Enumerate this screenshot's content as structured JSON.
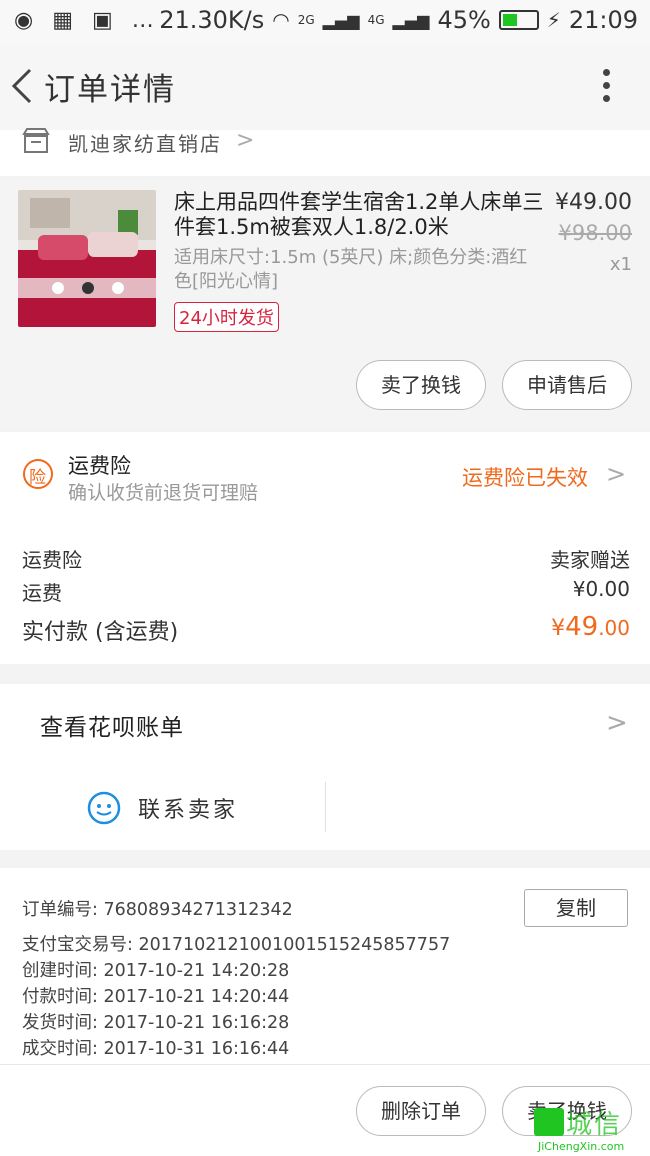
{
  "status_bar": {
    "left_icons": "◉ ▦ ▣ …",
    "net_speed": "21.30K/s",
    "signal_2g": "2G",
    "signal_4g": "4G",
    "battery_percent": "45%",
    "time": "21:09"
  },
  "header": {
    "title": "订单详情"
  },
  "shop": {
    "name": "凯迪家纺直销店"
  },
  "product": {
    "title": "床上用品四件套学生宿舍1.2单人床单三件套1.5m被套双人1.8/2.0米",
    "spec": "适用床尺寸:1.5m (5英尺) 床;颜色分类:酒红色[阳光心情]",
    "badge": "24小时发货",
    "price_now": "¥49.00",
    "price_old": "¥98.00",
    "quantity": "x1",
    "actions": [
      "卖了换钱",
      "申请售后"
    ]
  },
  "insurance": {
    "title": "运费险",
    "desc": "确认收货前退货可理赔",
    "status": "运费险已失效",
    "icon_char": "险"
  },
  "fees": [
    {
      "label": "运费险",
      "value": "卖家赠送"
    },
    {
      "label": "运费",
      "value": "¥0.00"
    }
  ],
  "total": {
    "label": "实付款 (含运费)",
    "currency": "¥",
    "amount_int": "49",
    "amount_dec": ".00"
  },
  "bill": {
    "label": "查看花呗账单"
  },
  "contact": {
    "label": "联系卖家"
  },
  "order_info": {
    "order_no": "订单编号: 76808934271312342",
    "alipay_no": "支付宝交易号: 2017102121001001515245857757",
    "created": "创建时间: 2017-10-21 14:20:28",
    "paid": "付款时间: 2017-10-21 14:20:44",
    "shipped": "发货时间: 2017-10-21 16:16:28",
    "completed": "成交时间: 2017-10-31 16:16:44",
    "copy_label": "复制"
  },
  "bottom_actions": [
    "删除订单",
    "卖了换钱"
  ],
  "watermark": {
    "text": "城信",
    "url": "JiChengXin.com"
  },
  "colors": {
    "accent_orange": "#f06a1e",
    "badge_red": "#d8233f",
    "icon_blue": "#1e8fe0"
  }
}
